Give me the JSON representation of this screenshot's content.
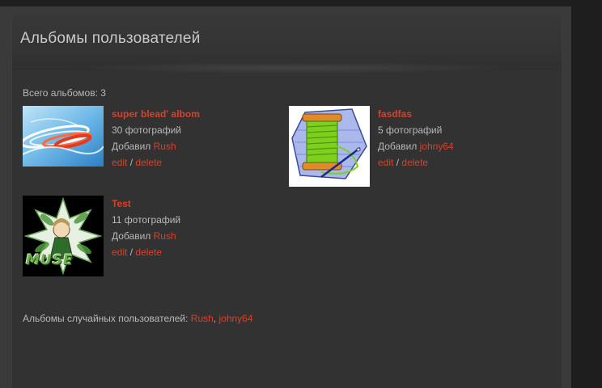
{
  "page": {
    "title": "Альбомы пользователей",
    "total_label": "Всего альбомов: 3"
  },
  "albums": [
    {
      "title": "super blead' albom",
      "photos": "30 фотографий",
      "added_by_label": "Добавил",
      "user": "Rush",
      "edit": "edit",
      "separator": "/",
      "delete": "delete",
      "thumb_icon": "abstract-swirl-thumbnail"
    },
    {
      "title": "fasdfas",
      "photos": "5 фотографий",
      "added_by_label": "Добавил",
      "user": "johny64",
      "edit": "edit",
      "separator": "/",
      "delete": "delete",
      "thumb_icon": "thread-spool-thumbnail"
    },
    {
      "title": "Test",
      "photos": "11 фотографий",
      "added_by_label": "Добавил",
      "user": "Rush",
      "edit": "edit",
      "separator": "/",
      "delete": "delete",
      "thumb_icon": "anime-muse-thumbnail",
      "thumb_text": "MUSE"
    }
  ],
  "random_users": {
    "label": "Альбомы случайных пользователей:",
    "users": [
      "Rush",
      "johny64"
    ],
    "separator": ","
  },
  "colors": {
    "link": "#d9402a",
    "text": "#b8b8b8",
    "background": "#323232"
  }
}
